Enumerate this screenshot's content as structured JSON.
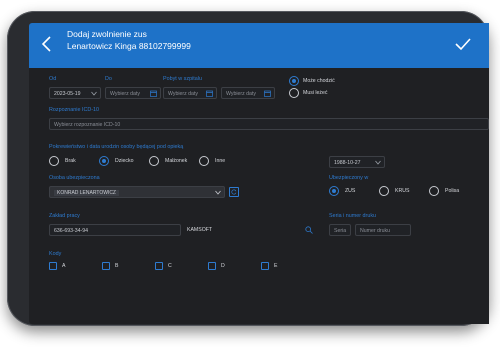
{
  "header": {
    "title_line1": "Dodaj zwolnienie zus",
    "title_line2": "Lenartowicz Kinga 88102799999"
  },
  "dates": {
    "od_label": "Od",
    "od_value": "2023-05-19",
    "do_label": "Do",
    "do_placeholder": "Wybierz daty",
    "pobyt_label": "Pobyt w szpitalu",
    "pobyt_from_placeholder": "Wybierz daty",
    "pobyt_to_placeholder": "Wybierz daty"
  },
  "walking": {
    "options": [
      {
        "label": "Może chodzić",
        "selected": true
      },
      {
        "label": "Musi leżeć",
        "selected": false
      }
    ]
  },
  "icd": {
    "label": "Rozpoznanie ICD-10",
    "placeholder": "Wybierz rozpoznanie ICD-10"
  },
  "relation": {
    "label": "Pokrewieństwo i data urodzin osoby będącej pod opieką",
    "options": [
      {
        "label": "Brak",
        "selected": false
      },
      {
        "label": "Dziecko",
        "selected": true
      },
      {
        "label": "Małżonek",
        "selected": false
      },
      {
        "label": "Inne",
        "selected": false
      }
    ],
    "birth_date": "1988-10-27"
  },
  "insured": {
    "label": "Osoba ubezpieczona",
    "value": "KONRAD LENARTOWICZ"
  },
  "insured_in": {
    "label": "Ubezpieczony w",
    "options": [
      {
        "label": "ZUS",
        "selected": true
      },
      {
        "label": "KRUS",
        "selected": false
      },
      {
        "label": "Polisa",
        "selected": false
      }
    ]
  },
  "employer": {
    "label": "Zakład pracy",
    "nip": "636-693-34-94",
    "name": "KAMSOFT"
  },
  "print": {
    "label": "Seria i numer druku",
    "series_placeholder": "Seria",
    "number_placeholder": "Numer druku"
  },
  "codes": {
    "label": "Kody",
    "items": [
      "A",
      "B",
      "C",
      "D",
      "E"
    ]
  },
  "colors": {
    "header": "#1e72c8",
    "accent": "#2e7bd0",
    "background": "#1f2023"
  }
}
